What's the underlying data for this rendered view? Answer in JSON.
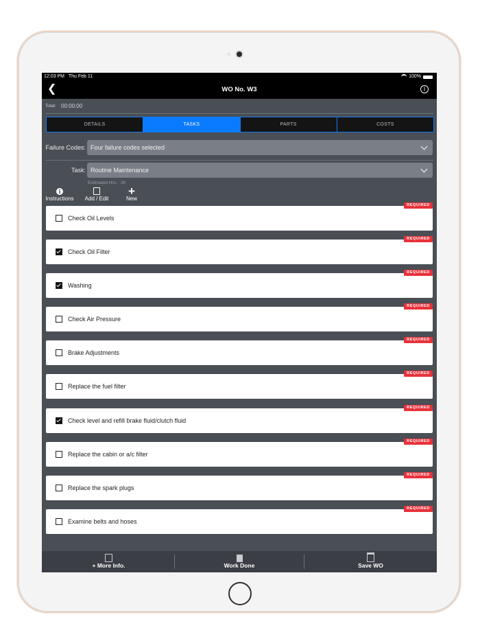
{
  "status_bar": {
    "time": "12:03 PM",
    "date": "Thu Feb 11",
    "battery": "100%"
  },
  "nav": {
    "title": "WO No. W3",
    "back_icon": "chevron-left-icon",
    "info_icon": "info-circle-icon"
  },
  "total": {
    "label": "Total:",
    "value": "00:00:00"
  },
  "tabs": [
    {
      "label": "DETAILS",
      "active": false
    },
    {
      "label": "TASKS",
      "active": true
    },
    {
      "label": "PARTS",
      "active": false
    },
    {
      "label": "COSTS",
      "active": false
    }
  ],
  "failure_codes": {
    "label": "Failure Codes:",
    "value": "Four failure codes selected"
  },
  "task": {
    "label": "Task:",
    "value": "Routine Maintenance",
    "estimated_label": "Estimated Hrs.:",
    "estimated_value": "2h"
  },
  "actions": [
    {
      "label": "Instructions",
      "icon": "info-icon"
    },
    {
      "label": "Add / Edit",
      "icon": "edit-doc-icon"
    },
    {
      "label": "New",
      "icon": "plus-icon"
    }
  ],
  "required_badge": "REQUIRED",
  "tasks": [
    {
      "label": "Check Oil Levels",
      "checked": false
    },
    {
      "label": "Check Oil Filter",
      "checked": true
    },
    {
      "label": "Washing",
      "checked": true
    },
    {
      "label": "Check Air Pressure",
      "checked": false
    },
    {
      "label": "Brake Adjustments",
      "checked": false
    },
    {
      "label": "Replace the fuel filter",
      "checked": false
    },
    {
      "label": "Check level and refill brake fluid/clutch fluid",
      "checked": true
    },
    {
      "label": "Replace the cabin or a/c filter",
      "checked": false
    },
    {
      "label": "Replace the spark plugs",
      "checked": false
    },
    {
      "label": "Examine belts and hoses",
      "checked": false
    }
  ],
  "bottom_bar": [
    {
      "label": "+ More Info.",
      "icon": "export-icon"
    },
    {
      "label": "Work Done",
      "icon": "document-icon"
    },
    {
      "label": "Save WO",
      "icon": "save-icon"
    }
  ],
  "colors": {
    "accent": "#0a7bff",
    "required": "#e8313a",
    "screen_bg": "#4a4e55"
  }
}
